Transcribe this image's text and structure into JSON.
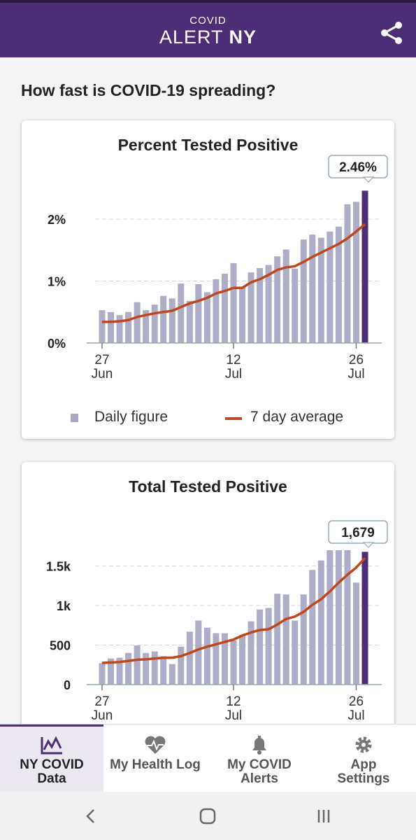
{
  "header": {
    "logo_small": "COVID",
    "logo_alert": "ALERT",
    "logo_ny": "NY",
    "share_icon": "share-icon"
  },
  "page_heading": "How fast is COVID-19 spreading?",
  "colors": {
    "brand": "#4d2d75",
    "bar": "#aeadc8",
    "bar_latest": "#4d2d75",
    "line": "#c0461b"
  },
  "chart_data": [
    {
      "type": "bar",
      "title": "Percent Tested Positive",
      "callout": "2.46%",
      "y_ticks": [
        "0%",
        "1%",
        "2%"
      ],
      "y_tick_values": [
        0,
        1,
        2
      ],
      "ylim": [
        0,
        2.6
      ],
      "x_ticks": [
        [
          "27",
          "Jun"
        ],
        [
          "12",
          "Jul"
        ],
        [
          "26",
          "Jul"
        ]
      ],
      "x_tick_index": [
        0,
        15,
        29
      ],
      "series": [
        {
          "name": "Daily figure",
          "kind": "bar",
          "values": [
            0.53,
            0.5,
            0.45,
            0.5,
            0.66,
            0.53,
            0.62,
            0.76,
            0.72,
            0.96,
            0.68,
            0.95,
            0.82,
            1.03,
            1.12,
            1.29,
            0.9,
            1.14,
            1.21,
            1.26,
            1.4,
            1.51,
            1.2,
            1.67,
            1.75,
            1.7,
            1.8,
            1.88,
            2.24,
            2.28,
            2.46
          ]
        },
        {
          "name": "7 day average",
          "kind": "line",
          "values": [
            0.34,
            0.34,
            0.35,
            0.37,
            0.42,
            0.45,
            0.48,
            0.5,
            0.52,
            0.58,
            0.64,
            0.68,
            0.73,
            0.8,
            0.84,
            0.89,
            0.89,
            0.98,
            1.03,
            1.1,
            1.18,
            1.22,
            1.24,
            1.31,
            1.39,
            1.46,
            1.53,
            1.6,
            1.69,
            1.8,
            1.92
          ]
        }
      ],
      "legend": [
        "Daily figure",
        "7 day average"
      ],
      "legend_position": "bottom",
      "grid": true
    },
    {
      "type": "bar",
      "title": "Total Tested Positive",
      "callout": "1,679",
      "y_ticks": [
        "0",
        "500",
        "1k",
        "1.5k"
      ],
      "y_tick_values": [
        0,
        500,
        1000,
        1500
      ],
      "ylim": [
        0,
        1700
      ],
      "x_ticks": [
        [
          "27",
          "Jun"
        ],
        [
          "12",
          "Jul"
        ],
        [
          "26",
          "Jul"
        ]
      ],
      "x_tick_index": [
        0,
        15,
        29
      ],
      "series": [
        {
          "name": "Daily figure",
          "kind": "bar",
          "values": [
            270,
            330,
            340,
            400,
            495,
            400,
            420,
            360,
            260,
            480,
            670,
            810,
            720,
            650,
            650,
            560,
            630,
            800,
            950,
            970,
            1150,
            1140,
            810,
            1140,
            1450,
            1570,
            1700,
            1700,
            1700,
            1290,
            1679
          ]
        },
        {
          "name": "7 day average",
          "kind": "line",
          "values": [
            275,
            280,
            285,
            300,
            315,
            320,
            330,
            340,
            340,
            360,
            400,
            445,
            480,
            510,
            540,
            570,
            620,
            660,
            690,
            700,
            760,
            830,
            860,
            920,
            1010,
            1080,
            1180,
            1290,
            1390,
            1480,
            1600
          ]
        }
      ],
      "grid": true
    }
  ],
  "bottom_nav": [
    {
      "label_1": "NY COVID",
      "label_2": "Data",
      "icon": "chart-icon",
      "active": true
    },
    {
      "label_1": "My Health Log",
      "label_2": "",
      "icon": "heart-pulse-icon",
      "active": false
    },
    {
      "label_1": "My COVID",
      "label_2": "Alerts",
      "icon": "bell-icon",
      "active": false
    },
    {
      "label_1": "App",
      "label_2": "Settings",
      "icon": "gear-icon",
      "active": false
    }
  ],
  "system_nav": [
    "back-icon",
    "home-icon",
    "recents-icon"
  ]
}
